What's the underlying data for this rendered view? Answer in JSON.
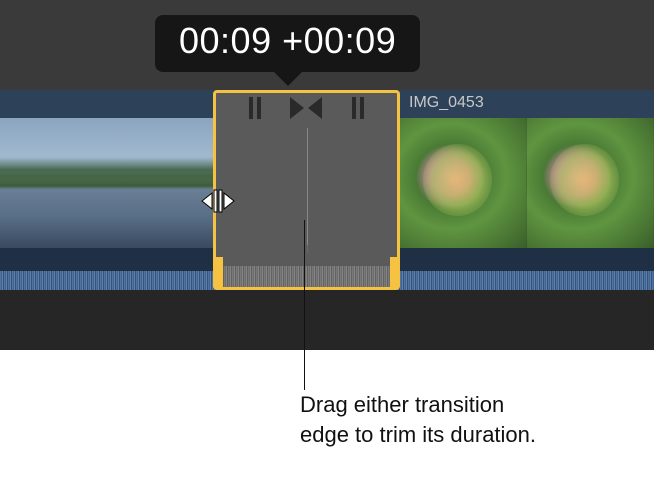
{
  "tooltip": {
    "current": "00:09",
    "delta": "+00:09"
  },
  "clip": {
    "name": "IMG_0453"
  },
  "annotation": {
    "line1": "Drag either transition",
    "line2": "edge to trim its duration."
  },
  "icons": {
    "transition_center": "bowtie-icon",
    "transition_side": "pause-bars-icon",
    "trim_cursor": "trim-edge-arrows-icon"
  },
  "colors": {
    "selection": "#f5c242",
    "tooltip_bg": "#141414",
    "timeline_header": "#2d4159",
    "audio_bg": "#1f2f44"
  }
}
